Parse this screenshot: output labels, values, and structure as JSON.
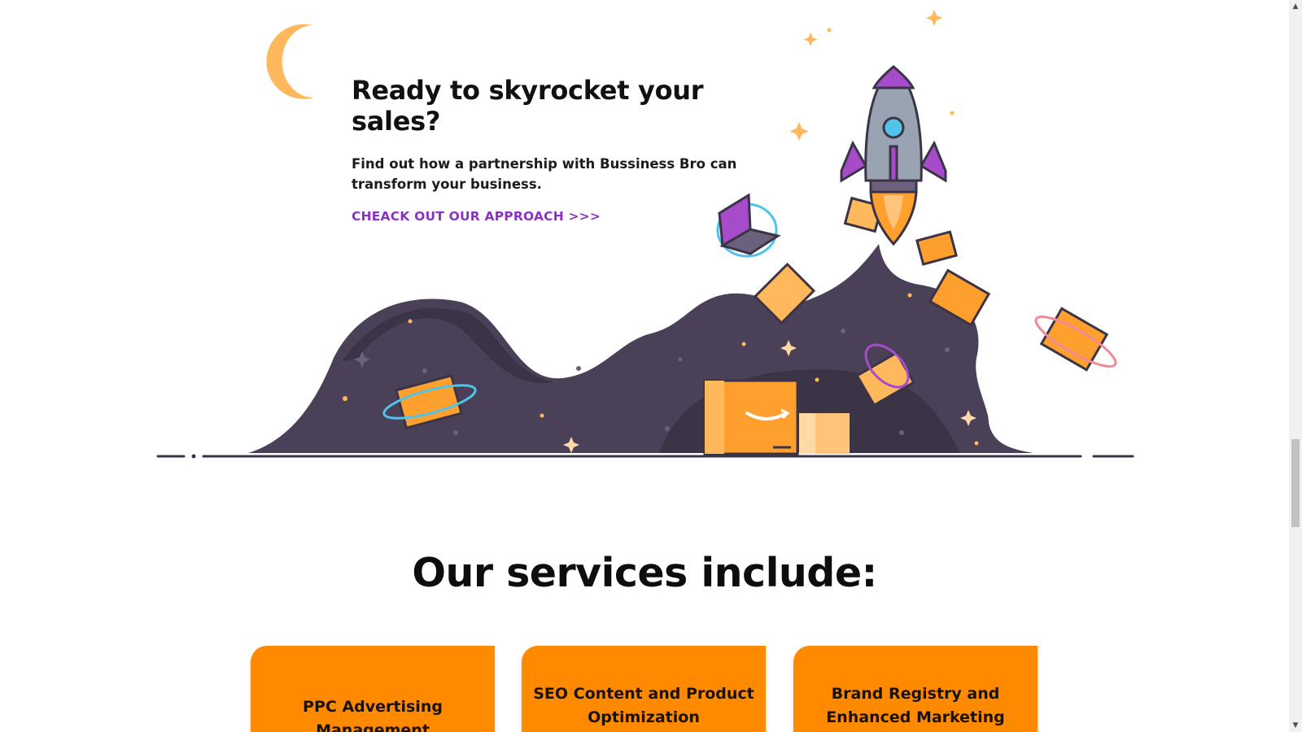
{
  "hero": {
    "title": "Ready to skyrocket your sales?",
    "description": "Find out how a partnership with Bussiness Bro can transform your business.",
    "cta_link": "CHEACK OUT OUR APPROACH >>>"
  },
  "illustration": {
    "icon": "rocket-launch-illustration",
    "colors": {
      "mountain": "#4a4158",
      "mountain_dark": "#3b3447",
      "box_orange": "#ff9f2e",
      "box_light": "#ffc47a",
      "moon": "#ffb85c",
      "rocket_body": "#9aa3b2",
      "rocket_fins": "#a64bc9",
      "accent_purple": "#8a33c4",
      "ring_blue": "#4fc3e8",
      "ring_pink": "#f08a9a"
    }
  },
  "services": {
    "heading": "Our services include:",
    "items": [
      {
        "label": "PPC Advertising Management"
      },
      {
        "label": "SEO Content and Product Optimization"
      },
      {
        "label": "Brand Registry and Enhanced Marketing"
      }
    ]
  },
  "colors": {
    "card_background": "#ff8a00",
    "link": "#8a33c4",
    "text": "#111111"
  }
}
